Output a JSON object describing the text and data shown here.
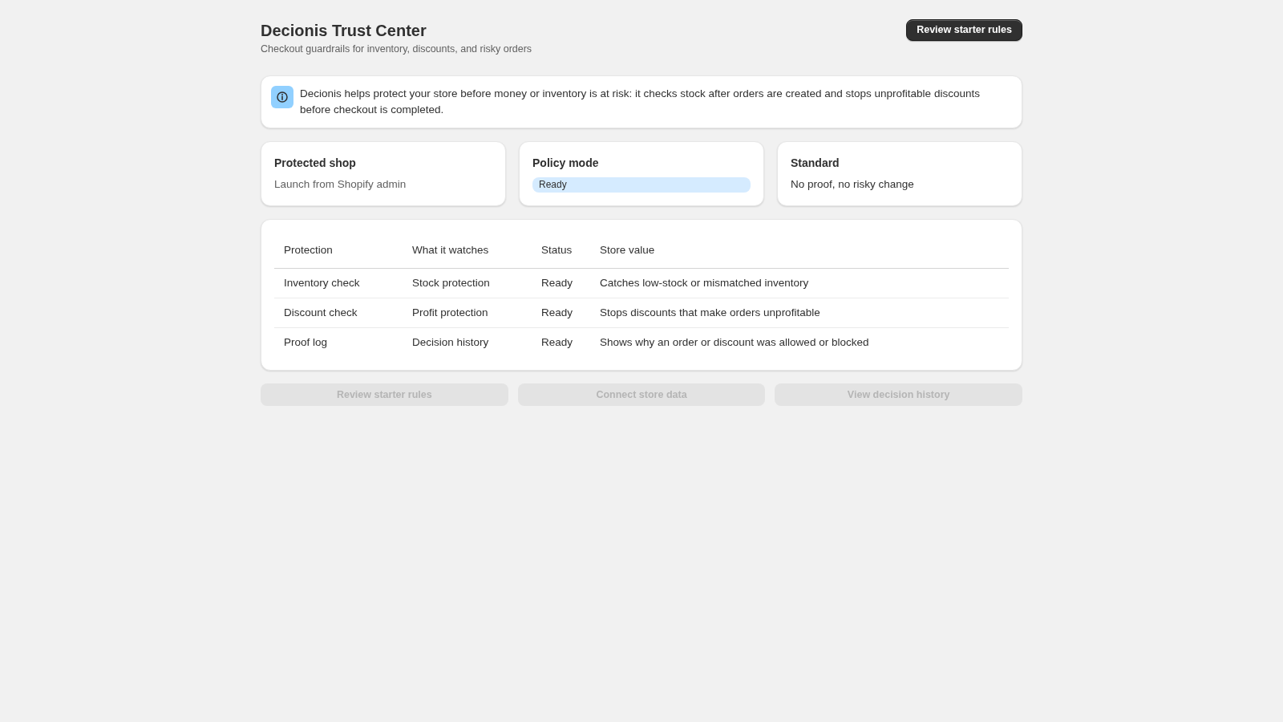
{
  "header": {
    "title": "Decionis Trust Center",
    "subtitle": "Checkout guardrails for inventory, discounts, and risky orders",
    "action": {
      "label": "Review starter rules"
    }
  },
  "banner": {
    "text": "Decionis helps protect your store before money or inventory is at risk: it checks stock after orders are created and stops unprofitable discounts before checkout is completed."
  },
  "summary_cards": [
    {
      "title": "Protected shop",
      "kind": "note",
      "value": "Launch from Shopify admin"
    },
    {
      "title": "Policy mode",
      "kind": "badge",
      "value": "Ready"
    },
    {
      "title": "Standard",
      "kind": "text",
      "value": "No proof, no risky change"
    }
  ],
  "table": {
    "columns": [
      "Protection",
      "What it watches",
      "Status",
      "Store value"
    ],
    "rows": [
      [
        "Inventory check",
        "Stock protection",
        "Ready",
        "Catches low-stock or mismatched inventory"
      ],
      [
        "Discount check",
        "Profit protection",
        "Ready",
        "Stops discounts that make orders unprofitable"
      ],
      [
        "Proof log",
        "Decision history",
        "Ready",
        "Shows why an order or discount was allowed or blocked"
      ]
    ]
  },
  "actions": [
    {
      "label": "Review starter rules",
      "disabled": true
    },
    {
      "label": "Connect store data",
      "disabled": true
    },
    {
      "label": "View decision history",
      "disabled": true
    }
  ]
}
